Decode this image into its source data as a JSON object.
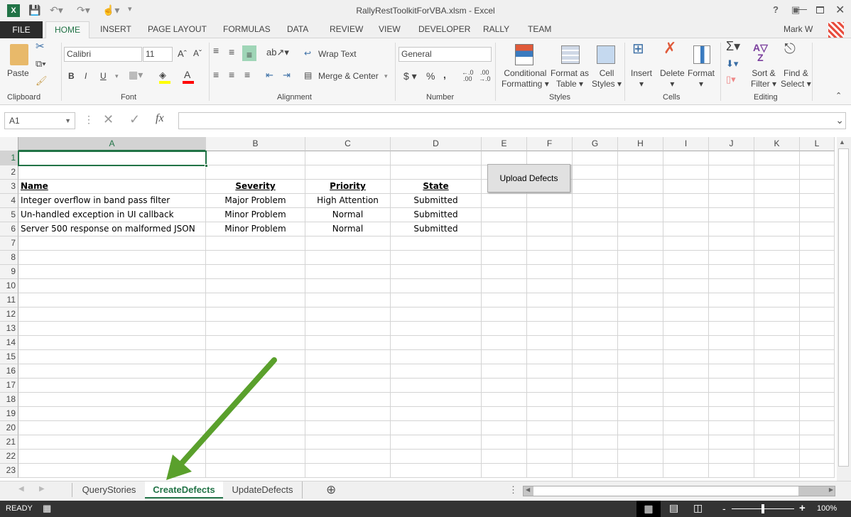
{
  "window": {
    "title": "RallyRestToolkitForVBA.xlsm - Excel",
    "user": "Mark W",
    "controls": [
      "?",
      "restore-ribbon",
      "minimize",
      "maximize",
      "close"
    ]
  },
  "ribbon": {
    "tabs": [
      "FILE",
      "HOME",
      "INSERT",
      "PAGE LAYOUT",
      "FORMULAS",
      "DATA",
      "REVIEW",
      "VIEW",
      "DEVELOPER",
      "RALLY",
      "TEAM"
    ],
    "active_tab": "HOME",
    "groups": {
      "clipboard": "Clipboard",
      "font": "Font",
      "alignment": "Alignment",
      "number": "Number",
      "styles": "Styles",
      "cells": "Cells",
      "editing": "Editing"
    },
    "paste": "Paste",
    "font_name": "Calibri",
    "font_size": "11",
    "wrap_text": "Wrap Text",
    "merge_center": "Merge & Center",
    "number_format": "General",
    "conditional": [
      "Conditional",
      "Formatting"
    ],
    "format_table": [
      "Format as",
      "Table"
    ],
    "cell_styles": [
      "Cell",
      "Styles"
    ],
    "insert": "Insert",
    "delete": "Delete",
    "format": "Format",
    "sort": [
      "Sort &",
      "Filter"
    ],
    "find": [
      "Find &",
      "Select"
    ],
    "bold": "B",
    "italic": "I",
    "underline": "U",
    "fill_color": "#ffff00",
    "font_color": "#ff0000"
  },
  "formula_bar": {
    "name_box": "A1",
    "fx": "fx",
    "value": ""
  },
  "sheet": {
    "columns": [
      "A",
      "B",
      "C",
      "D",
      "E",
      "F",
      "G",
      "H",
      "I",
      "J",
      "K",
      "L"
    ],
    "rows": [
      "1",
      "2",
      "3",
      "4",
      "5",
      "6",
      "7",
      "8",
      "9",
      "10",
      "11",
      "12",
      "13",
      "14",
      "15",
      "16",
      "17",
      "18",
      "19",
      "20",
      "21",
      "22",
      "23"
    ],
    "selected_cell": "A1",
    "headers": [
      "Name",
      "Severity",
      "Priority",
      "State"
    ],
    "data": [
      [
        "Integer overflow in band pass filter",
        "Major Problem",
        "High Attention",
        "Submitted"
      ],
      [
        "Un-handled exception in UI callback",
        "Minor Problem",
        "Normal",
        "Submitted"
      ],
      [
        "Server 500 response on malformed JSON",
        "Minor Problem",
        "Normal",
        "Submitted"
      ]
    ],
    "button": "Upload Defects"
  },
  "sheet_tabs": {
    "tabs": [
      "QueryStories",
      "CreateDefects",
      "UpdateDefects"
    ],
    "active": "CreateDefects",
    "accent": "#217346"
  },
  "annotation": {
    "arrow_color": "#5aa02c"
  },
  "status": {
    "text": "READY",
    "zoom": "100%",
    "zoom_level": 100
  }
}
